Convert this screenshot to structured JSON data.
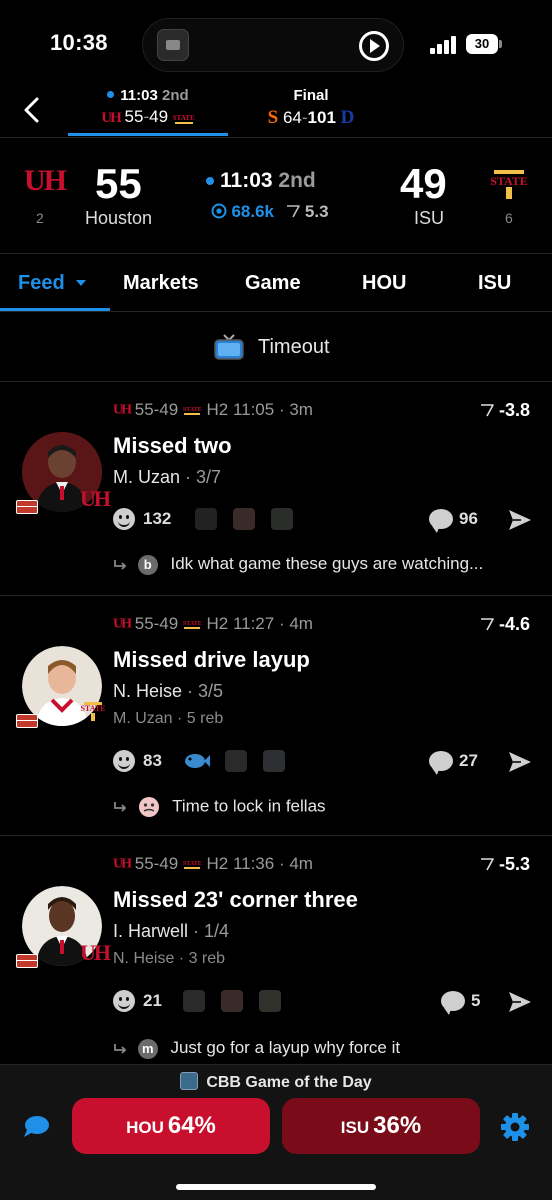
{
  "status_bar": {
    "time": "10:38",
    "battery": "30"
  },
  "games": [
    {
      "clock": "11:03",
      "period": "2nd",
      "score_home": "55",
      "score_away": "49"
    },
    {
      "status": "Final",
      "score_home": "64",
      "score_away": "101"
    }
  ],
  "scoreboard": {
    "home": {
      "score": "55",
      "name": "Houston",
      "seed": "2"
    },
    "away": {
      "score": "49",
      "name": "ISU",
      "seed": "6"
    },
    "clock": "11:03",
    "period": "2nd",
    "viewers": "68.6k",
    "spread": "5.3"
  },
  "nav_tabs": [
    "Feed",
    "Markets",
    "Game",
    "HOU",
    "ISU"
  ],
  "timeout_label": "Timeout",
  "feed": [
    {
      "score": "55-49",
      "time": "H2 11:05",
      "ago": "3m",
      "delta": "-3.8",
      "title": "Missed two",
      "player": "M. Uzan",
      "stat": "3/7",
      "assist": "",
      "reactions": "132",
      "comments": "96",
      "reply_initial": "b",
      "reply": "Idk what game these guys are watching..."
    },
    {
      "score": "55-49",
      "time": "H2 11:27",
      "ago": "4m",
      "delta": "-4.6",
      "title": "Missed drive layup",
      "player": "N. Heise",
      "stat": "3/5",
      "assist": "M. Uzan · 5 reb",
      "reactions": "83",
      "comments": "27",
      "reply_initial": "",
      "reply": "Time to lock in fellas"
    },
    {
      "score": "55-49",
      "time": "H2 11:36",
      "ago": "4m",
      "delta": "-5.3",
      "title": "Missed 23' corner three",
      "player": "I. Harwell",
      "stat": "1/4",
      "assist": "N. Heise · 3 reb",
      "reactions": "21",
      "comments": "5",
      "reply_initial": "m",
      "reply": "Just go for a layup why force it"
    }
  ],
  "game_of_day": "CBB Game of the Day",
  "odds": {
    "home": {
      "team": "HOU",
      "pct": "64%",
      "color": "#c8102e"
    },
    "away": {
      "team": "ISU",
      "pct": "36%",
      "color": "#7a0b18"
    }
  },
  "colors": {
    "accent": "#1e90e8",
    "uh_red": "#c8102e",
    "isu_gold": "#f1be48",
    "duke_blue": "#1a3aa8",
    "cuse_orange": "#f76900"
  }
}
